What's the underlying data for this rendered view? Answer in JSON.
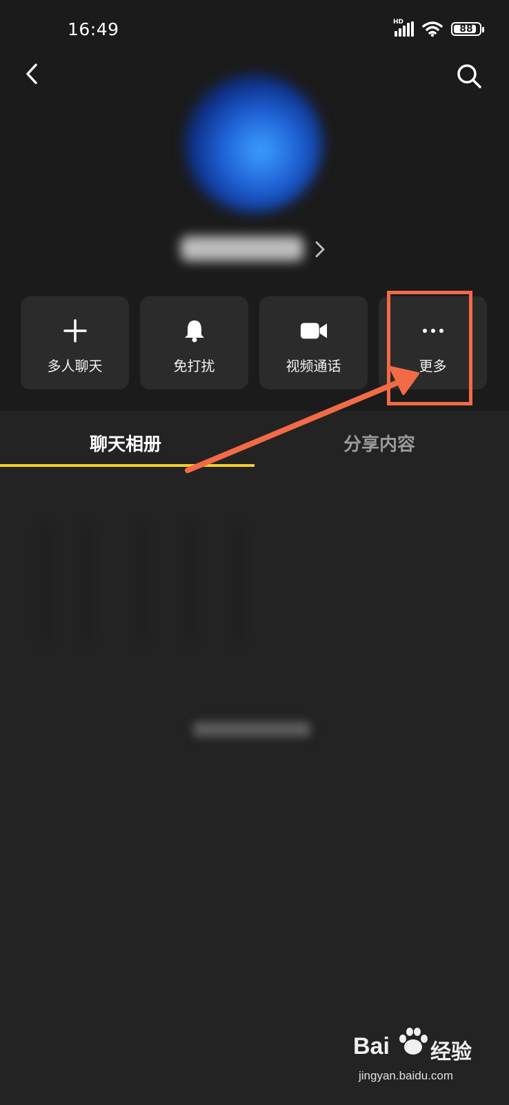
{
  "status_bar": {
    "time": "16:49",
    "network_label": "HD",
    "battery_level": "88",
    "icons": [
      "signal-icon",
      "wifi-icon",
      "battery-icon"
    ]
  },
  "header": {
    "back_icon": "chevron-left-icon",
    "search_icon": "search-icon"
  },
  "profile": {
    "name_blurred": true
  },
  "actions": [
    {
      "label": "多人聊天",
      "icon": "plus-icon"
    },
    {
      "label": "免打扰",
      "icon": "bell-icon"
    },
    {
      "label": "视频通话",
      "icon": "video-camera-icon"
    },
    {
      "label": "更多",
      "icon": "more-dots-icon"
    }
  ],
  "tabs": [
    {
      "label": "聊天相册",
      "active": true
    },
    {
      "label": "分享内容",
      "active": false
    }
  ],
  "annotation": {
    "highlight_color": "#f36b46",
    "highlight_target": "更多"
  },
  "watermark": {
    "brand": "Bai",
    "brand_suffix": "经验",
    "url": "jingyan.baidu.com"
  },
  "colors": {
    "background": "#232323",
    "header_background": "#1b1b1b",
    "button_background": "#2b2b2b",
    "tab_indicator": "#f3cf2a"
  }
}
